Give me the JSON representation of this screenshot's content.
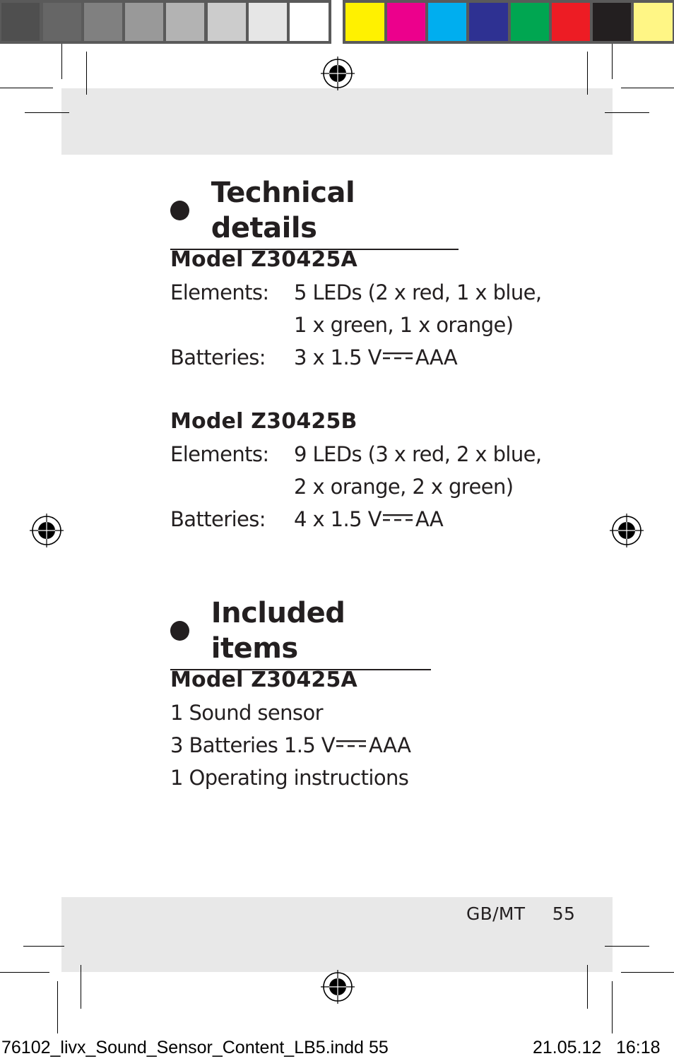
{
  "color_bar": {
    "grays": [
      "#4f4f4f",
      "#666666",
      "#808080",
      "#999999",
      "#b3b3b3",
      "#cccccc",
      "#e6e6e6",
      "#ffffff"
    ],
    "colors": [
      "#fff100",
      "#ec008c",
      "#00aeef",
      "#2e3192",
      "#00a651",
      "#ed1c24",
      "#231f20",
      "#fff685"
    ]
  },
  "sections": {
    "technical": {
      "title": "Technical details",
      "model_a": {
        "title": "Model Z30425A",
        "elements_label": "Elements:",
        "elements_line1": "5 LEDs (2 x red, 1 x blue,",
        "elements_line2": "1 x green, 1 x orange)",
        "batteries_label": "Batteries:",
        "batteries_pre": "3 x 1.5 V",
        "batteries_post": "AAA"
      },
      "model_b": {
        "title": "Model Z30425B",
        "elements_label": "Elements:",
        "elements_line1": "9 LEDs (3 x red, 2 x blue,",
        "elements_line2": "2 x orange, 2 x green)",
        "batteries_label": "Batteries:",
        "batteries_pre": "4 x 1.5 V",
        "batteries_post": "AA"
      }
    },
    "included": {
      "title": "Included items",
      "model_a": {
        "title": "Model Z30425A",
        "item1": "1 Sound sensor",
        "item2_pre": "3 Batteries 1.5 V",
        "item2_post": "AAA",
        "item3": "1 Operating instructions"
      }
    }
  },
  "footer": {
    "language": "GB/MT",
    "page_number": "55"
  },
  "slug": {
    "filename": "76102_livx_Sound_Sensor_Content_LB5.indd",
    "page": "55",
    "date": "21.05.12",
    "time": "16:18"
  },
  "icons": {
    "dc_symbol": "direct-current-symbol",
    "bullet": "filled-circle-bullet",
    "registration": "registration-target"
  }
}
